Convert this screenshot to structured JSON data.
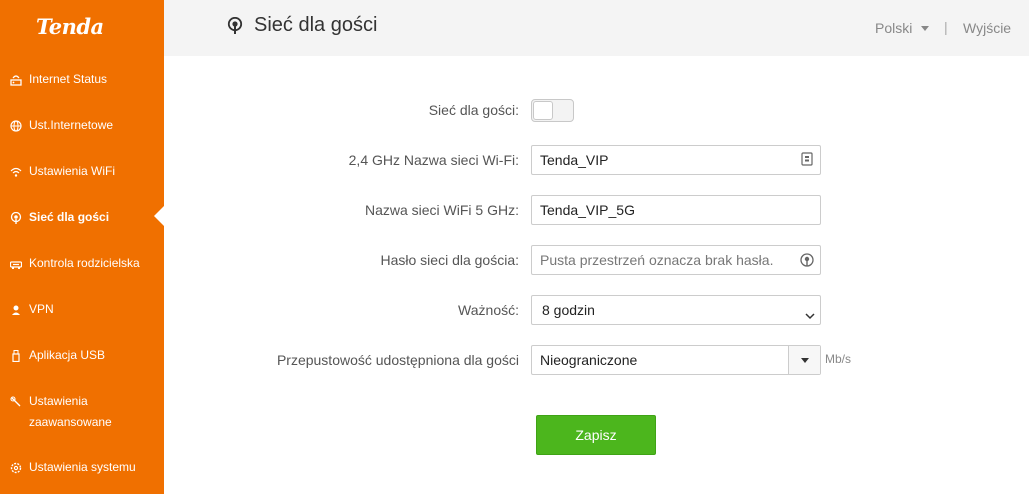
{
  "sidebar": {
    "logo": "Tenda",
    "items": [
      {
        "label": "Internet Status",
        "icon": "router-icon"
      },
      {
        "label": "Ust.Internetowe",
        "icon": "globe-icon"
      },
      {
        "label": "Ustawienia WiFi",
        "icon": "wifi-icon"
      },
      {
        "label": "Sieć dla gości",
        "icon": "guest-network-icon",
        "active": true
      },
      {
        "label": "Kontrola rodzicielska",
        "icon": "parental-control-icon"
      },
      {
        "label": "VPN",
        "icon": "vpn-icon"
      },
      {
        "label": "Aplikacja USB",
        "icon": "usb-icon"
      },
      {
        "label": "Ustawienia zaawansowane",
        "icon": "wrench-icon"
      },
      {
        "label": "Ustawienia systemu",
        "icon": "gear-icon"
      }
    ]
  },
  "header": {
    "title": "Sieć dla gości",
    "language": "Polski",
    "separator": "|",
    "logout": "Wyjście"
  },
  "form": {
    "guest_network_label": "Sieć dla gości:",
    "guest_network_enabled": false,
    "ssid_24_label": "2,4 GHz Nazwa sieci Wi-Fi:",
    "ssid_24_value": "Tenda_VIP",
    "ssid_5_label": "Nazwa sieci WiFi 5 GHz:",
    "ssid_5_value": "Tenda_VIP_5G",
    "password_label": "Hasło sieci dla gościa:",
    "password_placeholder": "Pusta przestrzeń oznacza brak hasła.",
    "validity_label": "Ważność:",
    "validity_value": "8 godzin",
    "bandwidth_label": "Przepustowość udostępniona dla gości",
    "bandwidth_value": "Nieograniczone",
    "bandwidth_unit": "Mb/s",
    "save_label": "Zapisz"
  },
  "colors": {
    "sidebar": "#f07000",
    "save_button": "#4cb61d"
  }
}
